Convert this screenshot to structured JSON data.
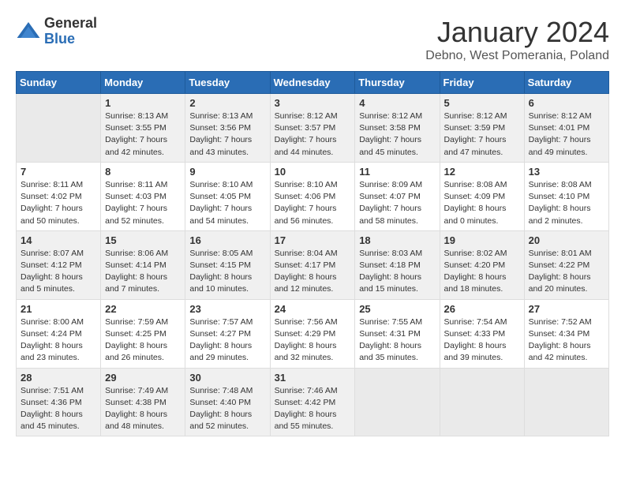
{
  "header": {
    "logo_general": "General",
    "logo_blue": "Blue",
    "month_year": "January 2024",
    "location": "Debno, West Pomerania, Poland"
  },
  "weekdays": [
    "Sunday",
    "Monday",
    "Tuesday",
    "Wednesday",
    "Thursday",
    "Friday",
    "Saturday"
  ],
  "weeks": [
    [
      {
        "day": "",
        "sunrise": "",
        "sunset": "",
        "daylight": ""
      },
      {
        "day": "1",
        "sunrise": "Sunrise: 8:13 AM",
        "sunset": "Sunset: 3:55 PM",
        "daylight": "Daylight: 7 hours and 42 minutes."
      },
      {
        "day": "2",
        "sunrise": "Sunrise: 8:13 AM",
        "sunset": "Sunset: 3:56 PM",
        "daylight": "Daylight: 7 hours and 43 minutes."
      },
      {
        "day": "3",
        "sunrise": "Sunrise: 8:12 AM",
        "sunset": "Sunset: 3:57 PM",
        "daylight": "Daylight: 7 hours and 44 minutes."
      },
      {
        "day": "4",
        "sunrise": "Sunrise: 8:12 AM",
        "sunset": "Sunset: 3:58 PM",
        "daylight": "Daylight: 7 hours and 45 minutes."
      },
      {
        "day": "5",
        "sunrise": "Sunrise: 8:12 AM",
        "sunset": "Sunset: 3:59 PM",
        "daylight": "Daylight: 7 hours and 47 minutes."
      },
      {
        "day": "6",
        "sunrise": "Sunrise: 8:12 AM",
        "sunset": "Sunset: 4:01 PM",
        "daylight": "Daylight: 7 hours and 49 minutes."
      }
    ],
    [
      {
        "day": "7",
        "sunrise": "Sunrise: 8:11 AM",
        "sunset": "Sunset: 4:02 PM",
        "daylight": "Daylight: 7 hours and 50 minutes."
      },
      {
        "day": "8",
        "sunrise": "Sunrise: 8:11 AM",
        "sunset": "Sunset: 4:03 PM",
        "daylight": "Daylight: 7 hours and 52 minutes."
      },
      {
        "day": "9",
        "sunrise": "Sunrise: 8:10 AM",
        "sunset": "Sunset: 4:05 PM",
        "daylight": "Daylight: 7 hours and 54 minutes."
      },
      {
        "day": "10",
        "sunrise": "Sunrise: 8:10 AM",
        "sunset": "Sunset: 4:06 PM",
        "daylight": "Daylight: 7 hours and 56 minutes."
      },
      {
        "day": "11",
        "sunrise": "Sunrise: 8:09 AM",
        "sunset": "Sunset: 4:07 PM",
        "daylight": "Daylight: 7 hours and 58 minutes."
      },
      {
        "day": "12",
        "sunrise": "Sunrise: 8:08 AM",
        "sunset": "Sunset: 4:09 PM",
        "daylight": "Daylight: 8 hours and 0 minutes."
      },
      {
        "day": "13",
        "sunrise": "Sunrise: 8:08 AM",
        "sunset": "Sunset: 4:10 PM",
        "daylight": "Daylight: 8 hours and 2 minutes."
      }
    ],
    [
      {
        "day": "14",
        "sunrise": "Sunrise: 8:07 AM",
        "sunset": "Sunset: 4:12 PM",
        "daylight": "Daylight: 8 hours and 5 minutes."
      },
      {
        "day": "15",
        "sunrise": "Sunrise: 8:06 AM",
        "sunset": "Sunset: 4:14 PM",
        "daylight": "Daylight: 8 hours and 7 minutes."
      },
      {
        "day": "16",
        "sunrise": "Sunrise: 8:05 AM",
        "sunset": "Sunset: 4:15 PM",
        "daylight": "Daylight: 8 hours and 10 minutes."
      },
      {
        "day": "17",
        "sunrise": "Sunrise: 8:04 AM",
        "sunset": "Sunset: 4:17 PM",
        "daylight": "Daylight: 8 hours and 12 minutes."
      },
      {
        "day": "18",
        "sunrise": "Sunrise: 8:03 AM",
        "sunset": "Sunset: 4:18 PM",
        "daylight": "Daylight: 8 hours and 15 minutes."
      },
      {
        "day": "19",
        "sunrise": "Sunrise: 8:02 AM",
        "sunset": "Sunset: 4:20 PM",
        "daylight": "Daylight: 8 hours and 18 minutes."
      },
      {
        "day": "20",
        "sunrise": "Sunrise: 8:01 AM",
        "sunset": "Sunset: 4:22 PM",
        "daylight": "Daylight: 8 hours and 20 minutes."
      }
    ],
    [
      {
        "day": "21",
        "sunrise": "Sunrise: 8:00 AM",
        "sunset": "Sunset: 4:24 PM",
        "daylight": "Daylight: 8 hours and 23 minutes."
      },
      {
        "day": "22",
        "sunrise": "Sunrise: 7:59 AM",
        "sunset": "Sunset: 4:25 PM",
        "daylight": "Daylight: 8 hours and 26 minutes."
      },
      {
        "day": "23",
        "sunrise": "Sunrise: 7:57 AM",
        "sunset": "Sunset: 4:27 PM",
        "daylight": "Daylight: 8 hours and 29 minutes."
      },
      {
        "day": "24",
        "sunrise": "Sunrise: 7:56 AM",
        "sunset": "Sunset: 4:29 PM",
        "daylight": "Daylight: 8 hours and 32 minutes."
      },
      {
        "day": "25",
        "sunrise": "Sunrise: 7:55 AM",
        "sunset": "Sunset: 4:31 PM",
        "daylight": "Daylight: 8 hours and 35 minutes."
      },
      {
        "day": "26",
        "sunrise": "Sunrise: 7:54 AM",
        "sunset": "Sunset: 4:33 PM",
        "daylight": "Daylight: 8 hours and 39 minutes."
      },
      {
        "day": "27",
        "sunrise": "Sunrise: 7:52 AM",
        "sunset": "Sunset: 4:34 PM",
        "daylight": "Daylight: 8 hours and 42 minutes."
      }
    ],
    [
      {
        "day": "28",
        "sunrise": "Sunrise: 7:51 AM",
        "sunset": "Sunset: 4:36 PM",
        "daylight": "Daylight: 8 hours and 45 minutes."
      },
      {
        "day": "29",
        "sunrise": "Sunrise: 7:49 AM",
        "sunset": "Sunset: 4:38 PM",
        "daylight": "Daylight: 8 hours and 48 minutes."
      },
      {
        "day": "30",
        "sunrise": "Sunrise: 7:48 AM",
        "sunset": "Sunset: 4:40 PM",
        "daylight": "Daylight: 8 hours and 52 minutes."
      },
      {
        "day": "31",
        "sunrise": "Sunrise: 7:46 AM",
        "sunset": "Sunset: 4:42 PM",
        "daylight": "Daylight: 8 hours and 55 minutes."
      },
      {
        "day": "",
        "sunrise": "",
        "sunset": "",
        "daylight": ""
      },
      {
        "day": "",
        "sunrise": "",
        "sunset": "",
        "daylight": ""
      },
      {
        "day": "",
        "sunrise": "",
        "sunset": "",
        "daylight": ""
      }
    ]
  ]
}
